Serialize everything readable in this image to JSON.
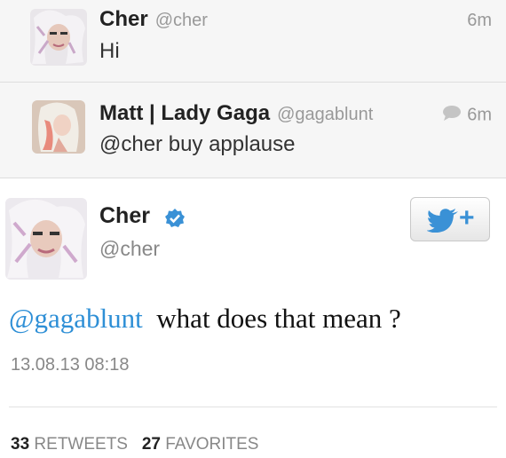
{
  "tweets": [
    {
      "name": "Cher",
      "handle": "@cher",
      "time": "6m",
      "text": "Hi"
    },
    {
      "name": "Matt | Lady Gaga",
      "handle": "@gagablunt",
      "time": "6m",
      "text": "@cher buy applause"
    }
  ],
  "main": {
    "name": "Cher",
    "handle": "@cher",
    "follow_plus": "+",
    "mention": "@gagablunt",
    "text": "what does that mean ?",
    "timestamp": "13.08.13 08:18",
    "retweets_count": "33",
    "retweets_label": "RETWEETS",
    "favorites_count": "27",
    "favorites_label": "FAVORITES"
  },
  "colors": {
    "link": "#2e8fd6",
    "verified": "#3a91d6",
    "muted": "#999999"
  }
}
